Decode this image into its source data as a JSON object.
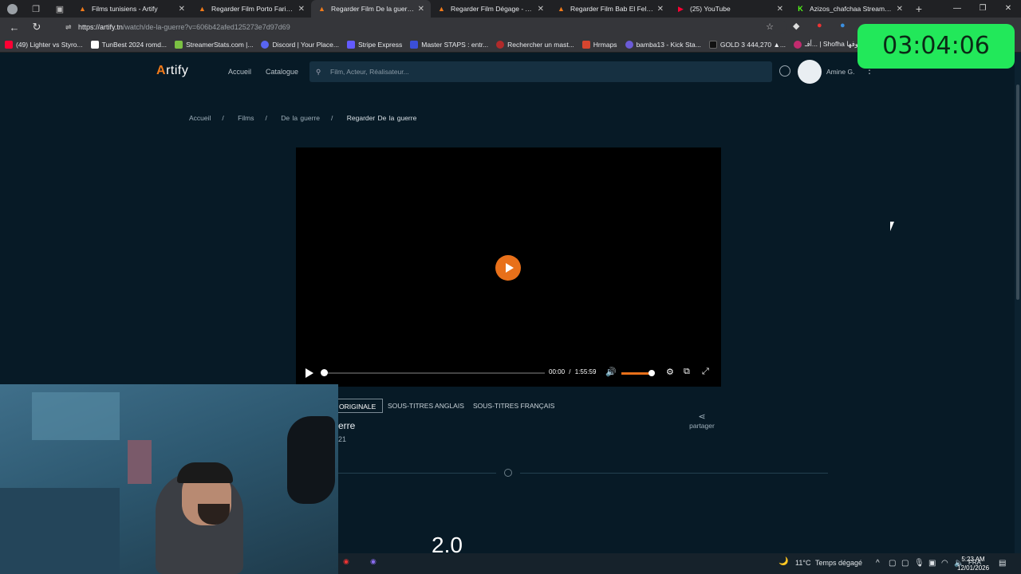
{
  "browser": {
    "tabs": [
      {
        "title": "Films tunisiens - Artify",
        "icon": "artify-icon"
      },
      {
        "title": "Regarder Film Porto Farina - A",
        "icon": "artify-icon"
      },
      {
        "title": "Regarder Film De la guerre - A",
        "icon": "artify-icon",
        "active": true
      },
      {
        "title": "Regarder Film Dégage - Artify",
        "icon": "artify-icon"
      },
      {
        "title": "Regarder Film Bab El Fella \"Le",
        "icon": "artify-icon"
      },
      {
        "title": "(25) YouTube",
        "icon": "youtube-icon"
      },
      {
        "title": "Azizos_chafchaa Stream - Wat",
        "icon": "kick-icon"
      }
    ],
    "url_host": "https://artify.tn",
    "url_path": "/watch/de-la-guerre?v=606b42afed125273e7d97d69",
    "bookmarks": [
      "(49) Lighter vs Styro...",
      "TunBest 2024 romd...",
      "StreamerStats.com |...",
      "Discord | Your Place...",
      "Stripe Express",
      "Master STAPS : entr...",
      "Rechercher un mast...",
      "Hrmaps",
      "bamba13 - Kick Sta...",
      "GOLD 3 444,270 ▲...",
      "أفـ... | Shofha شوفها"
    ]
  },
  "overlay": {
    "timer": "03:04:06"
  },
  "site": {
    "logo_a": "A",
    "logo_rest": "rtify",
    "nav": [
      "Accueil",
      "Catalogue"
    ],
    "search_placeholder": "Film, Acteur, Réalisateur...",
    "user_name": "Amine G."
  },
  "breadcrumb": [
    "Accueil",
    "Films",
    "De la guerre",
    "Regarder De la guerre"
  ],
  "player": {
    "current_time": "00:00",
    "separator": "/",
    "duration": "1:55:59",
    "progress": 0,
    "volume": 0.9
  },
  "subtitle_tabs": [
    "ORIGINALE",
    "SOUS-TITRES ANGLAIS",
    "SOUS-TITRES FRANÇAIS"
  ],
  "movie": {
    "title_fragment": "erre",
    "year_fragment": "21",
    "share_label": "partager",
    "rating": "2.0"
  },
  "taskbar": {
    "weather_temp": "11°C",
    "weather_text": "Temps dégagé",
    "lang": "FRA",
    "time": "5:23 AM",
    "date": "12/01/2026"
  }
}
